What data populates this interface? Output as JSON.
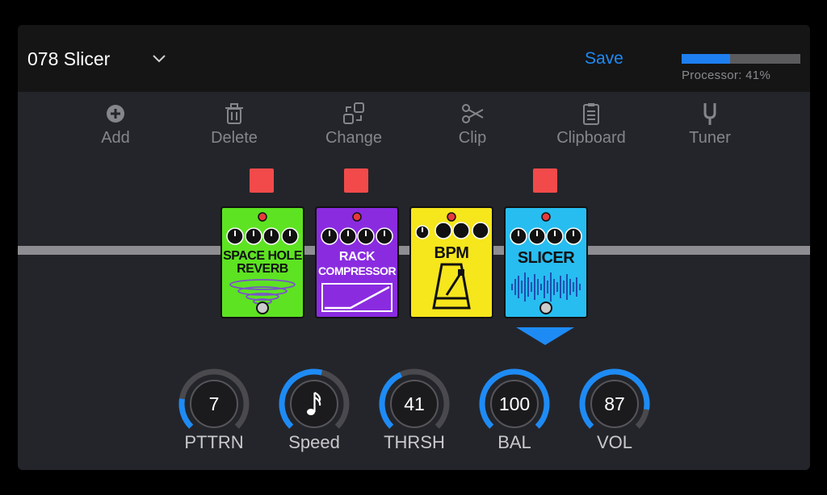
{
  "header": {
    "preset_name": "078 Slicer",
    "save_label": "Save",
    "processor_label": "Processor: 41%",
    "processor_percent": 41
  },
  "toolbar": [
    {
      "label": "Add",
      "icon": "add-icon"
    },
    {
      "label": "Delete",
      "icon": "trash-icon"
    },
    {
      "label": "Change",
      "icon": "change-icon"
    },
    {
      "label": "Clip",
      "icon": "scissors-icon"
    },
    {
      "label": "Clipboard",
      "icon": "clipboard-icon"
    },
    {
      "label": "Tuner",
      "icon": "tuning-fork-icon"
    }
  ],
  "pedals": [
    {
      "name_line1": "SPACE HOLE",
      "name_line2": "REVERB",
      "color": "#5de322",
      "bypass_indicator": true
    },
    {
      "name_line1": "RACK",
      "name_line2": "COMPRESSOR",
      "color": "#8a2be0",
      "bypass_indicator": true
    },
    {
      "name_line1": "BPM",
      "name_line2": "",
      "color": "#f6e61c",
      "bypass_indicator": false
    },
    {
      "name_line1": "SLICER",
      "name_line2": "",
      "color": "#27bdf0",
      "bypass_indicator": true,
      "selected": true
    }
  ],
  "knobs": [
    {
      "label": "PTTRN",
      "value": "7",
      "level": 0.2
    },
    {
      "label": "Speed",
      "value": "",
      "icon": "sixteenth-note-icon",
      "level": 0.55
    },
    {
      "label": "THRSH",
      "value": "41",
      "level": 0.41
    },
    {
      "label": "BAL",
      "value": "100",
      "level": 1.0
    },
    {
      "label": "VOL",
      "value": "87",
      "level": 0.87
    }
  ],
  "colors": {
    "accent": "#1e8bf5",
    "bypass_on": "#f24a4a",
    "track": "#4a4a4e"
  }
}
